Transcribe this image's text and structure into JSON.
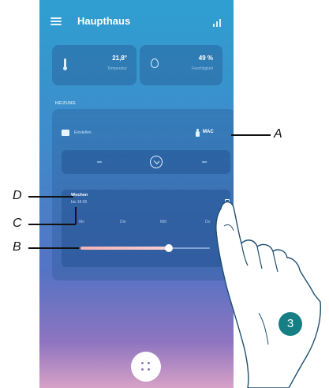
{
  "header": {
    "title": "Haupthaus",
    "menu_icon": "hamburger-menu-icon",
    "signal_icon": "signal-icon"
  },
  "climate": {
    "temperature": {
      "value": "21,8°",
      "label": "Temperatur",
      "icon": "thermometer-icon"
    },
    "humidity": {
      "value": "49 %",
      "label": "Feuchtigkeit",
      "icon": "droplet-icon"
    }
  },
  "heating": {
    "section_label": "HEIZUNG",
    "mode_label": "Einstellen",
    "mode_value": "MAC",
    "power_icon": "power-icon",
    "schedule": {
      "title": "Wochen",
      "subtitle": "bis 18:00",
      "days": [
        "Mo",
        "Die",
        "Mitt",
        "Do"
      ]
    },
    "slider": {
      "level_percent": 65
    }
  },
  "fab": {
    "icon": "grid-dots-icon"
  },
  "annotations": {
    "A": "A",
    "B": "B",
    "C": "C",
    "D": "D",
    "step": "3"
  },
  "colors": {
    "gradient_top": "#2f9fd0",
    "gradient_bottom": "#d6a1c6",
    "slider_active": "#f3b3b5",
    "step_badge": "#157f83"
  }
}
